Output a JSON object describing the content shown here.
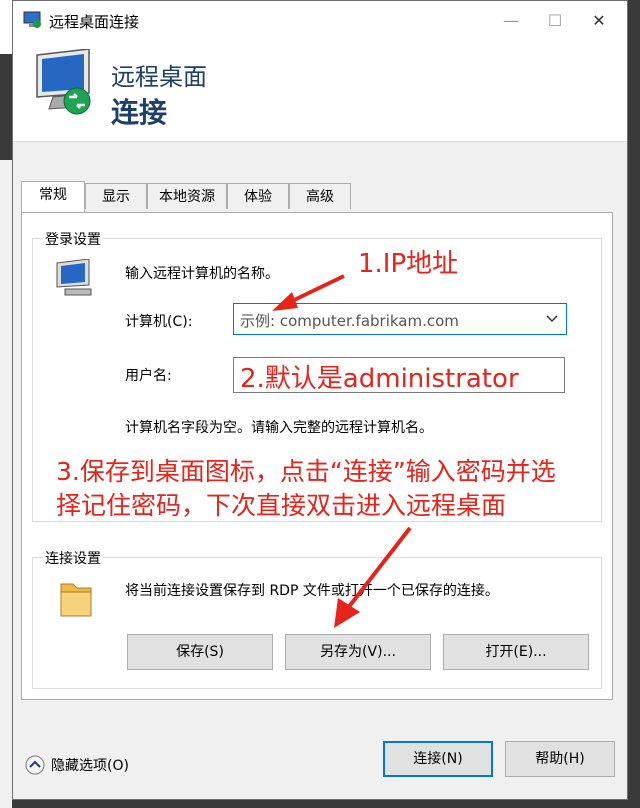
{
  "window": {
    "title": "远程桌面连接",
    "minimize": "—",
    "maximize": "☐",
    "close": "✕"
  },
  "header": {
    "line1": "远程桌面",
    "line2": "连接"
  },
  "tabs": [
    {
      "label": "常规"
    },
    {
      "label": "显示"
    },
    {
      "label": "本地资源"
    },
    {
      "label": "体验"
    },
    {
      "label": "高级"
    }
  ],
  "login": {
    "group_title": "登录设置",
    "prompt": "输入远程计算机的名称。",
    "computer_label": "计算机(C):",
    "computer_placeholder": "示例: computer.fabrikam.com",
    "username_label": "用户名:",
    "hint": "计算机名字段为空。请输入完整的远程计算机名。"
  },
  "connection": {
    "group_title": "连接设置",
    "desc": "将当前连接设置保存到 RDP 文件或打开一个已保存的连接。",
    "save": "保存(S)",
    "save_as": "另存为(V)...",
    "open": "打开(E)..."
  },
  "footer": {
    "options": "隐藏选项(O)",
    "connect": "连接(N)",
    "help": "帮助(H)"
  },
  "annotations": {
    "a1": "1.IP地址",
    "a2": "2.默认是administrator",
    "a3_line1": "3.保存到桌面图标，点击“连接”输入密码并选",
    "a3_line2": "择记住密码，下次直接双击进入远程桌面"
  },
  "colors": {
    "annotation": "#e8231a",
    "accent": "#0078d7",
    "header_text": "#1e3f6b"
  }
}
